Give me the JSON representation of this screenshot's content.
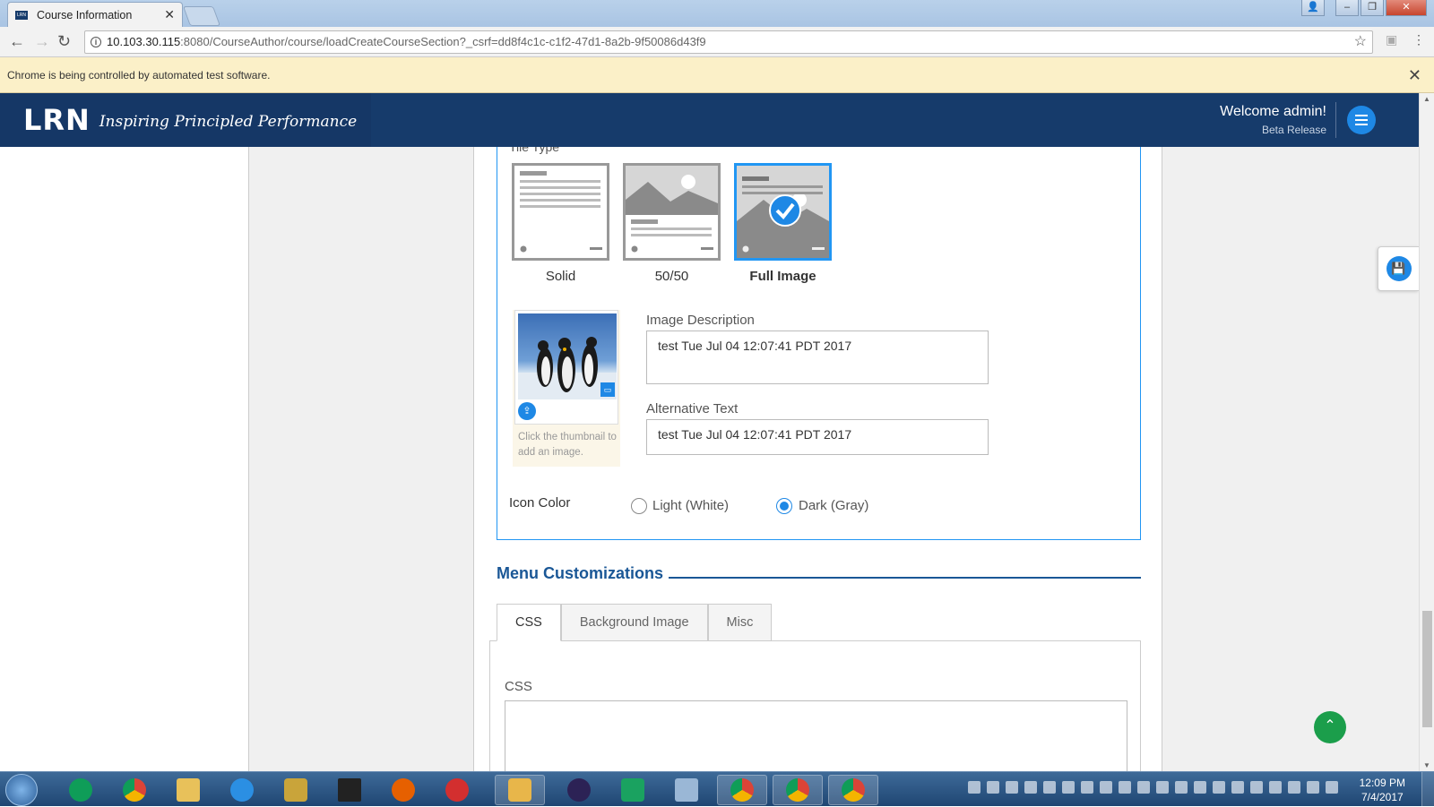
{
  "browser": {
    "tab_title": "Course Information",
    "url_host": "10.103.30.115",
    "url_rest": ":8080/CourseAuthor/course/loadCreateCourseSection?_csrf=dd8f4c1c-c1f2-47d1-8a2b-9f50086d43f9",
    "infobar_text": "Chrome is being controlled by automated test software."
  },
  "header": {
    "logo_text": "LRN",
    "tagline": "Inspiring Principled Performance",
    "welcome": "Welcome admin!",
    "release": "Beta Release"
  },
  "tile_type": {
    "label": "Tile Type",
    "options": [
      {
        "label": "Solid",
        "selected": false
      },
      {
        "label": "50/50",
        "selected": false
      },
      {
        "label": "Full Image",
        "selected": true
      }
    ]
  },
  "image": {
    "hint": "Click the thumbnail to add an image.",
    "description_label": "Image Description",
    "description_value": "test Tue Jul 04 12:07:41 PDT 2017",
    "alt_label": "Alternative Text",
    "alt_value": "test Tue Jul 04 12:07:41 PDT 2017"
  },
  "icon_color": {
    "label": "Icon Color",
    "options": [
      {
        "label": "Light (White)",
        "selected": false
      },
      {
        "label": "Dark (Gray)",
        "selected": true
      }
    ]
  },
  "menu": {
    "title": "Menu Customizations",
    "tabs": [
      "CSS",
      "Background Image",
      "Misc"
    ],
    "active_tab": "CSS",
    "css_label": "CSS",
    "css_value": ""
  },
  "taskbar": {
    "time": "12:09 PM",
    "date": "7/4/2017"
  },
  "colors": {
    "app_header": "#163b6b",
    "accent": "#1e88e5",
    "section_title": "#1a5796",
    "infobar": "#fbf0c8"
  }
}
